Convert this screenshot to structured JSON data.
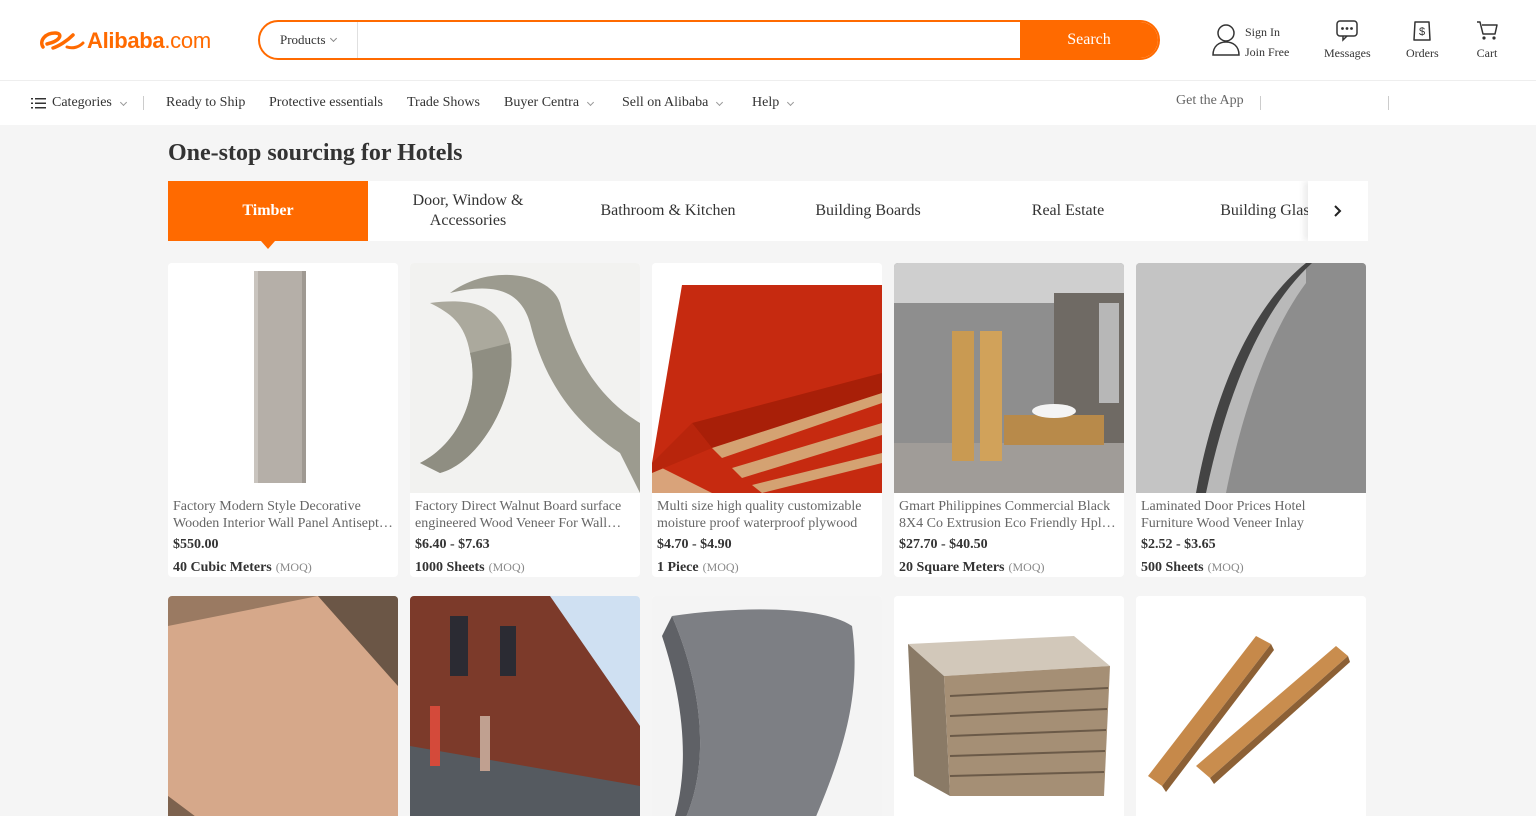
{
  "header": {
    "logo_text": "Alibaba",
    "logo_domain": ".com",
    "search": {
      "category": "Products",
      "placeholder": "",
      "button_label": "Search"
    },
    "user": {
      "sign_in": "Sign In",
      "join_free": "Join Free"
    },
    "icons": [
      {
        "label": "Messages",
        "icon": "messages-icon"
      },
      {
        "label": "Orders",
        "icon": "orders-icon"
      },
      {
        "label": "Cart",
        "icon": "cart-icon"
      }
    ]
  },
  "nav": {
    "categories": "Categories",
    "items": [
      "Ready to Ship",
      "Protective essentials",
      "Trade Shows",
      "Buyer Centra",
      "Sell on Alibaba",
      "Help"
    ],
    "get_app": "Get the App"
  },
  "main": {
    "title": "One-stop sourcing for Hotels",
    "tabs": [
      "Timber",
      "Door, Window &\nAccessories",
      "Bathroom & Kitchen",
      "Building Boards",
      "Real Estate",
      "Building Glass"
    ],
    "products": [
      {
        "title": "Factory Modern Style Decorative Wooden Interior Wall Panel Antiseptic Wood",
        "price": "$550.00",
        "moq": "40 Cubic Meters",
        "moq_tag": "(MOQ)"
      },
      {
        "title": "Factory Direct Walnut Board surface engineered Wood Veneer For Wall Panel",
        "price": "$6.40 - $7.63",
        "moq": "1000 Sheets",
        "moq_tag": "(MOQ)"
      },
      {
        "title": "Multi size high quality customizable moisture proof waterproof plywood",
        "price": "$4.70 - $4.90",
        "moq": "1 Piece",
        "moq_tag": "(MOQ)"
      },
      {
        "title": "Gmart Philippines Commercial Black 8X4 Co Extrusion Eco Friendly Hpl Board",
        "price": "$27.70 - $40.50",
        "moq": "20 Square Meters",
        "moq_tag": "(MOQ)"
      },
      {
        "title": "Laminated Door Prices Hotel Furniture Wood Veneer Inlay",
        "price": "$2.52 - $3.65",
        "moq": "500 Sheets",
        "moq_tag": "(MOQ)"
      }
    ]
  },
  "colors": {
    "accent": "#ff6a00",
    "page_bg": "#f5f5f5"
  }
}
